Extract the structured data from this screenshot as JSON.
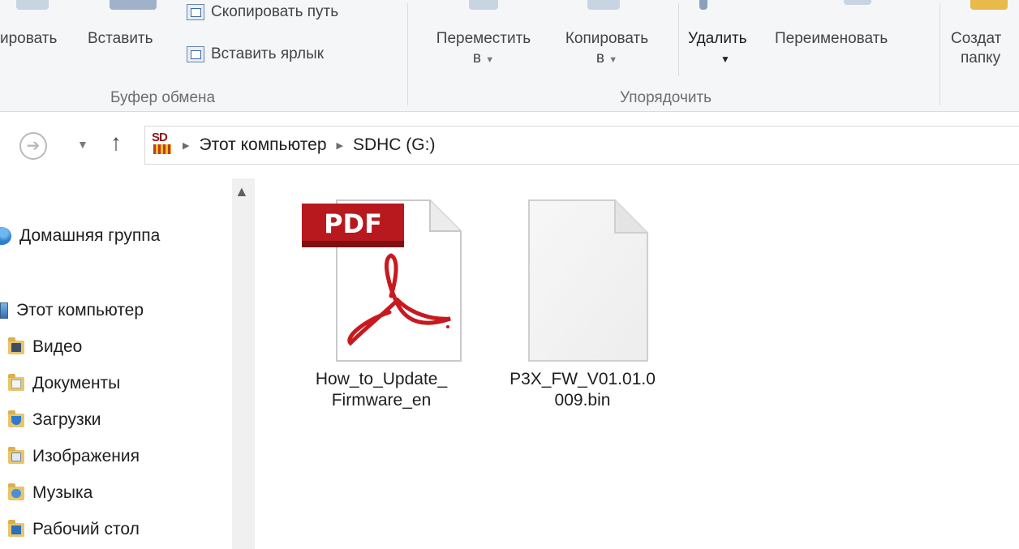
{
  "ribbon": {
    "clipboard": {
      "copy_label": "ировать",
      "paste_label": "Вставить",
      "copy_path_label": "Скопировать путь",
      "paste_shortcut_label": "Вставить ярлык",
      "group_label": "Буфер обмена"
    },
    "organize": {
      "move_to_label_line1": "Переместить",
      "move_to_label_line2": "в",
      "copy_to_label_line1": "Копировать",
      "copy_to_label_line2": "в",
      "delete_label": "Удалить",
      "rename_label": "Переименовать",
      "group_label": "Упорядочить"
    },
    "new": {
      "new_folder_line1": "Создат",
      "new_folder_line2": "папку"
    }
  },
  "address": {
    "crumbs": [
      "Этот компьютер",
      "SDHC (G:)"
    ]
  },
  "sidebar": {
    "items": [
      {
        "label": "Домашняя группа",
        "icon": "homegroup-icon"
      },
      {
        "label": "Этот компьютер",
        "icon": "computer-icon"
      },
      {
        "label": "Видео",
        "icon": "video-folder-icon"
      },
      {
        "label": "Документы",
        "icon": "documents-folder-icon"
      },
      {
        "label": "Загрузки",
        "icon": "downloads-folder-icon"
      },
      {
        "label": "Изображения",
        "icon": "pictures-folder-icon"
      },
      {
        "label": "Музыка",
        "icon": "music-folder-icon"
      },
      {
        "label": "Рабочий стол",
        "icon": "desktop-folder-icon"
      }
    ]
  },
  "files": [
    {
      "name_line1": "How_to_Update_",
      "name_line2": "Firmware_en",
      "icon": "pdf-file-icon",
      "icon_text": "PDF"
    },
    {
      "name_line1": "P3X_FW_V01.01.0",
      "name_line2": "009.bin",
      "icon": "blank-file-icon"
    }
  ],
  "colors": {
    "ribbon_bg": "#f5f6f7",
    "pdf_red": "#b7191e",
    "folder_yellow": "#e9c46a"
  }
}
